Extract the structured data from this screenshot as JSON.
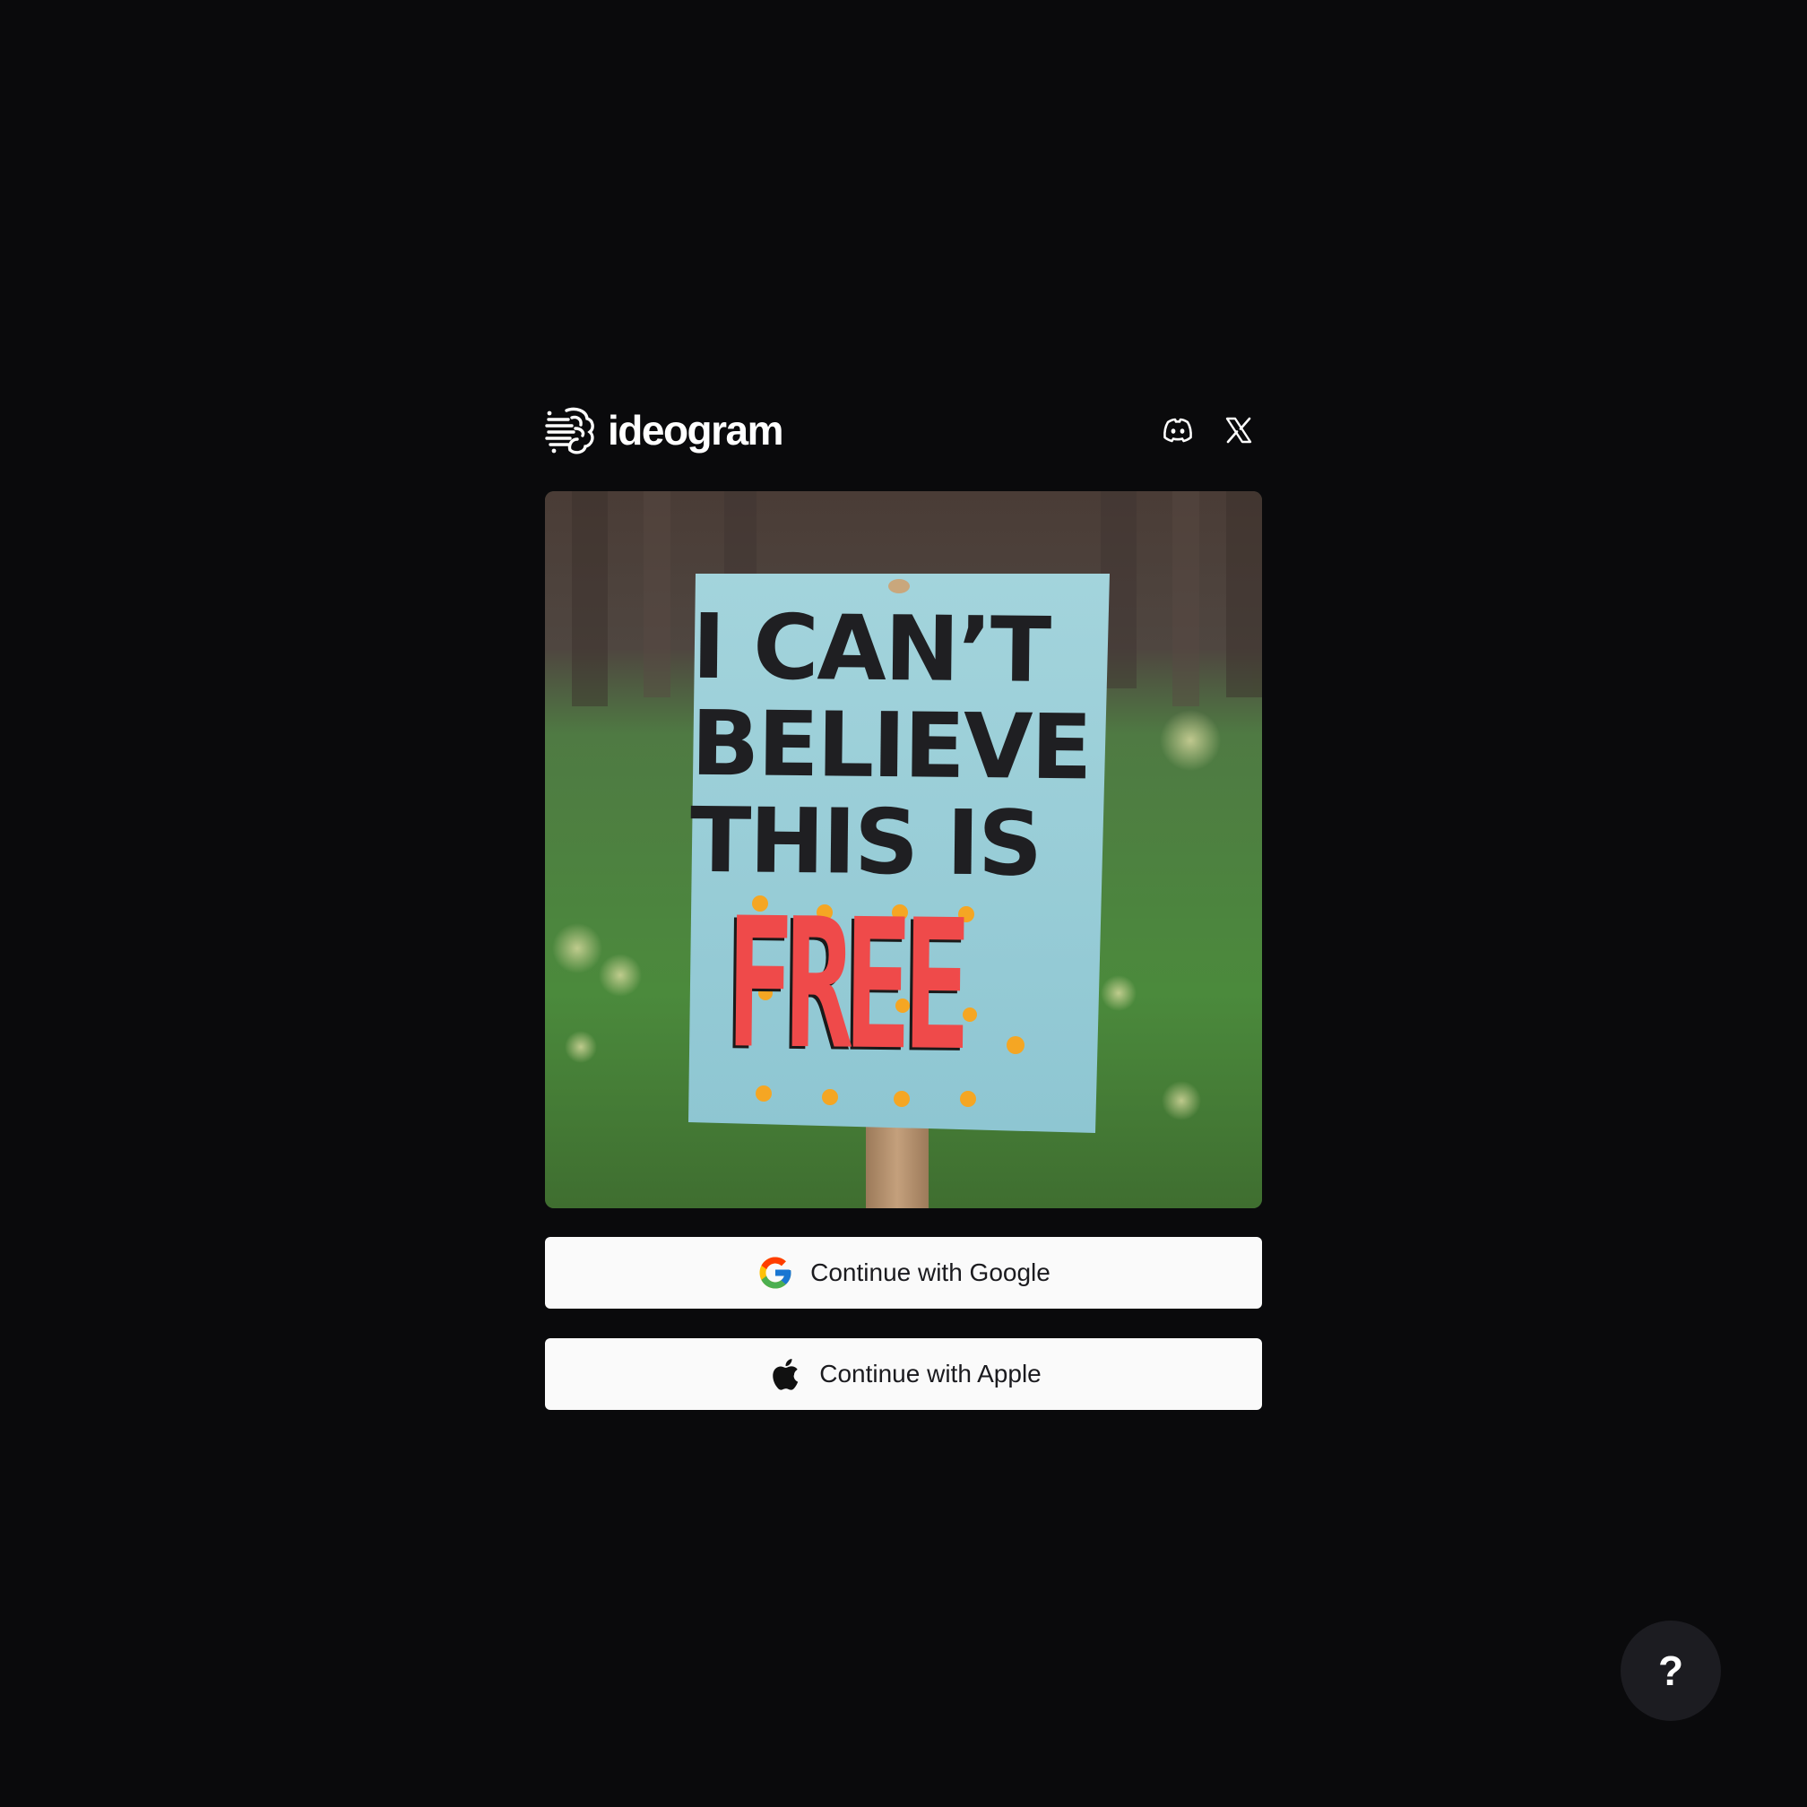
{
  "app": {
    "name": "ideogram"
  },
  "header": {
    "logo_icon": "ideogram-brain-icon",
    "socials": [
      {
        "icon": "discord-icon"
      },
      {
        "icon": "x-twitter-icon"
      }
    ]
  },
  "hero": {
    "sign_lines": [
      "I CAN’T",
      "BELIEVE",
      "THIS IS"
    ],
    "sign_highlight": "FREE"
  },
  "auth": {
    "google_label": "Continue with Google",
    "google_icon": "google-icon",
    "apple_label": "Continue with Apple",
    "apple_icon": "apple-icon"
  },
  "help": {
    "label": "?"
  },
  "colors": {
    "background": "#0a0a0c",
    "button_bg": "#fafafa",
    "button_text": "#1b1b1f",
    "help_bg": "#1c1c21",
    "sign_bg": "#9fd3dc",
    "free_red": "#ef4a4a",
    "free_orange": "#f5a623"
  }
}
